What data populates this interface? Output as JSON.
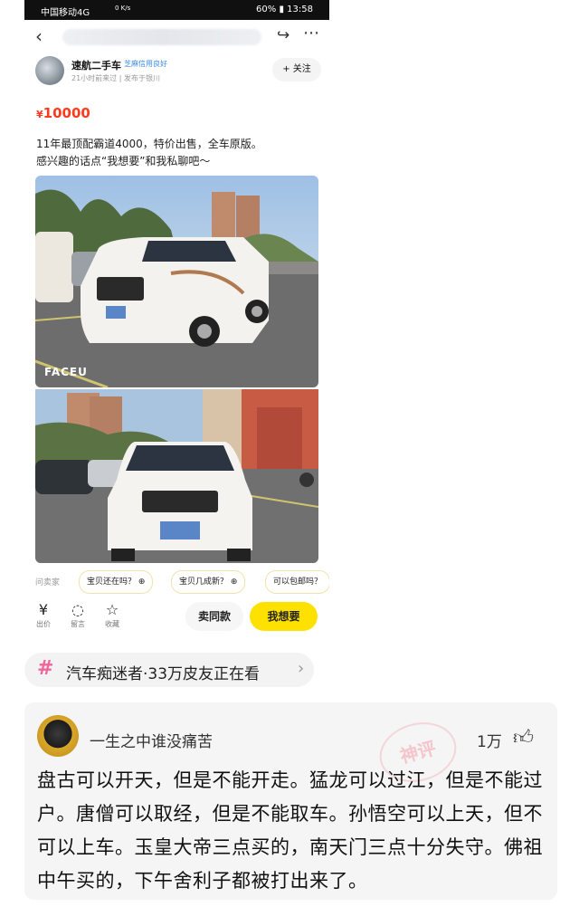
{
  "status_bar": {
    "carrier": "中国移动4G",
    "speed": "0 K/s",
    "battery": "60%",
    "time": "13:58"
  },
  "seller": {
    "name": "速航二手车",
    "credit_badge": "芝麻信用良好",
    "meta": "21小时前来过 | 发布于银川",
    "follow_label": "+ 关注"
  },
  "listing": {
    "currency": "¥",
    "price": "10000",
    "desc_line1": "11年最顶配霸道4000，特价出售，全车原版。",
    "desc_line2": "感兴趣的话点“我想要”和我私聊吧～",
    "watermark": "FACEU"
  },
  "ask_seller": {
    "label": "问卖家",
    "chips": [
      "宝贝还在吗？",
      "宝贝几成新？",
      "可以包邮吗？"
    ]
  },
  "bottom_bar": {
    "actions": [
      {
        "icon": "yen-circle-icon",
        "label": "出价"
      },
      {
        "icon": "chat-bubble-icon",
        "label": "留言"
      },
      {
        "icon": "star-icon",
        "label": "收藏"
      }
    ],
    "sell_same_label": "卖同款",
    "want_label": "我想要"
  },
  "topic": {
    "text": "汽车痴迷者·33万皮友正在看"
  },
  "comment": {
    "user": "一生之中谁没痛苦",
    "likes": "1万",
    "stamp": "神评",
    "text": "盘古可以开天，但是不能开走。猛龙可以过江，但是不能过户。唐僧可以取经，但是不能取车。孙悟空可以上天，但不可以上车。玉皇大帝三点买的，南天门三点十分失守。佛祖中午买的，下午舍利子都被打出来了。"
  },
  "colors": {
    "price": "#ff3b1f",
    "want_button": "#ffe100",
    "hash": "#f0669a"
  }
}
